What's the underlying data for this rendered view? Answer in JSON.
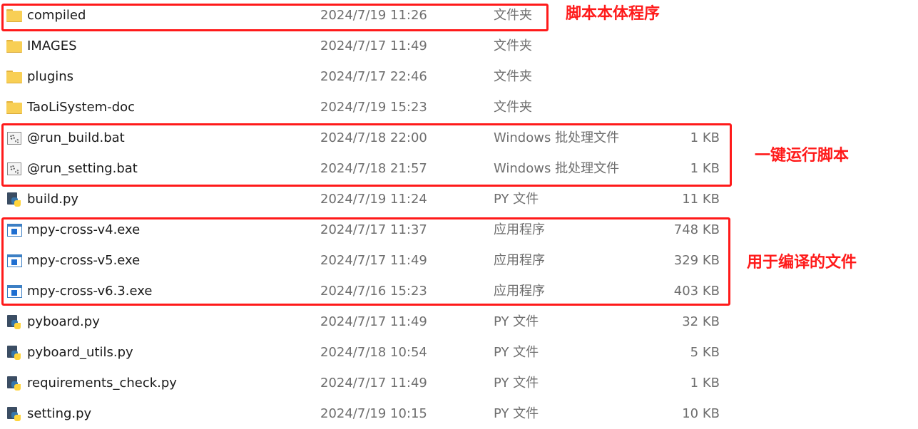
{
  "files": [
    {
      "icon": "folder-icon",
      "name": "compiled",
      "date": "2024/7/19 11:26",
      "type": "文件夹",
      "size": ""
    },
    {
      "icon": "folder-icon",
      "name": "IMAGES",
      "date": "2024/7/17 11:49",
      "type": "文件夹",
      "size": ""
    },
    {
      "icon": "folder-icon",
      "name": "plugins",
      "date": "2024/7/17 22:46",
      "type": "文件夹",
      "size": ""
    },
    {
      "icon": "folder-icon",
      "name": "TaoLiSystem-doc",
      "date": "2024/7/19 15:23",
      "type": "文件夹",
      "size": ""
    },
    {
      "icon": "batch-file-icon",
      "name": "@run_build.bat",
      "date": "2024/7/18 22:00",
      "type": "Windows 批处理文件",
      "size": "1 KB"
    },
    {
      "icon": "batch-file-icon",
      "name": "@run_setting.bat",
      "date": "2024/7/18 21:57",
      "type": "Windows 批处理文件",
      "size": "1 KB"
    },
    {
      "icon": "python-file-icon",
      "name": "build.py",
      "date": "2024/7/19 11:24",
      "type": "PY 文件",
      "size": "11 KB"
    },
    {
      "icon": "application-icon",
      "name": "mpy-cross-v4.exe",
      "date": "2024/7/17 11:37",
      "type": "应用程序",
      "size": "748 KB"
    },
    {
      "icon": "application-icon",
      "name": "mpy-cross-v5.exe",
      "date": "2024/7/17 11:49",
      "type": "应用程序",
      "size": "329 KB"
    },
    {
      "icon": "application-icon",
      "name": "mpy-cross-v6.3.exe",
      "date": "2024/7/16 15:23",
      "type": "应用程序",
      "size": "403 KB"
    },
    {
      "icon": "python-file-icon",
      "name": "pyboard.py",
      "date": "2024/7/17 11:49",
      "type": "PY 文件",
      "size": "32 KB"
    },
    {
      "icon": "python-file-icon",
      "name": "pyboard_utils.py",
      "date": "2024/7/18 10:54",
      "type": "PY 文件",
      "size": "5 KB"
    },
    {
      "icon": "python-file-icon",
      "name": "requirements_check.py",
      "date": "2024/7/17 11:49",
      "type": "PY 文件",
      "size": "1 KB"
    },
    {
      "icon": "python-file-icon",
      "name": "setting.py",
      "date": "2024/7/19 10:15",
      "type": "PY 文件",
      "size": "10 KB"
    }
  ],
  "annotations": {
    "script_body": "脚本本体程序",
    "one_click_scripts": "一键运行脚本",
    "compile_files": "用于编译的文件"
  },
  "colors": {
    "annotation": "#ff1a1a",
    "name_text": "#1a1a1a",
    "detail_text": "#6e6e6e"
  }
}
